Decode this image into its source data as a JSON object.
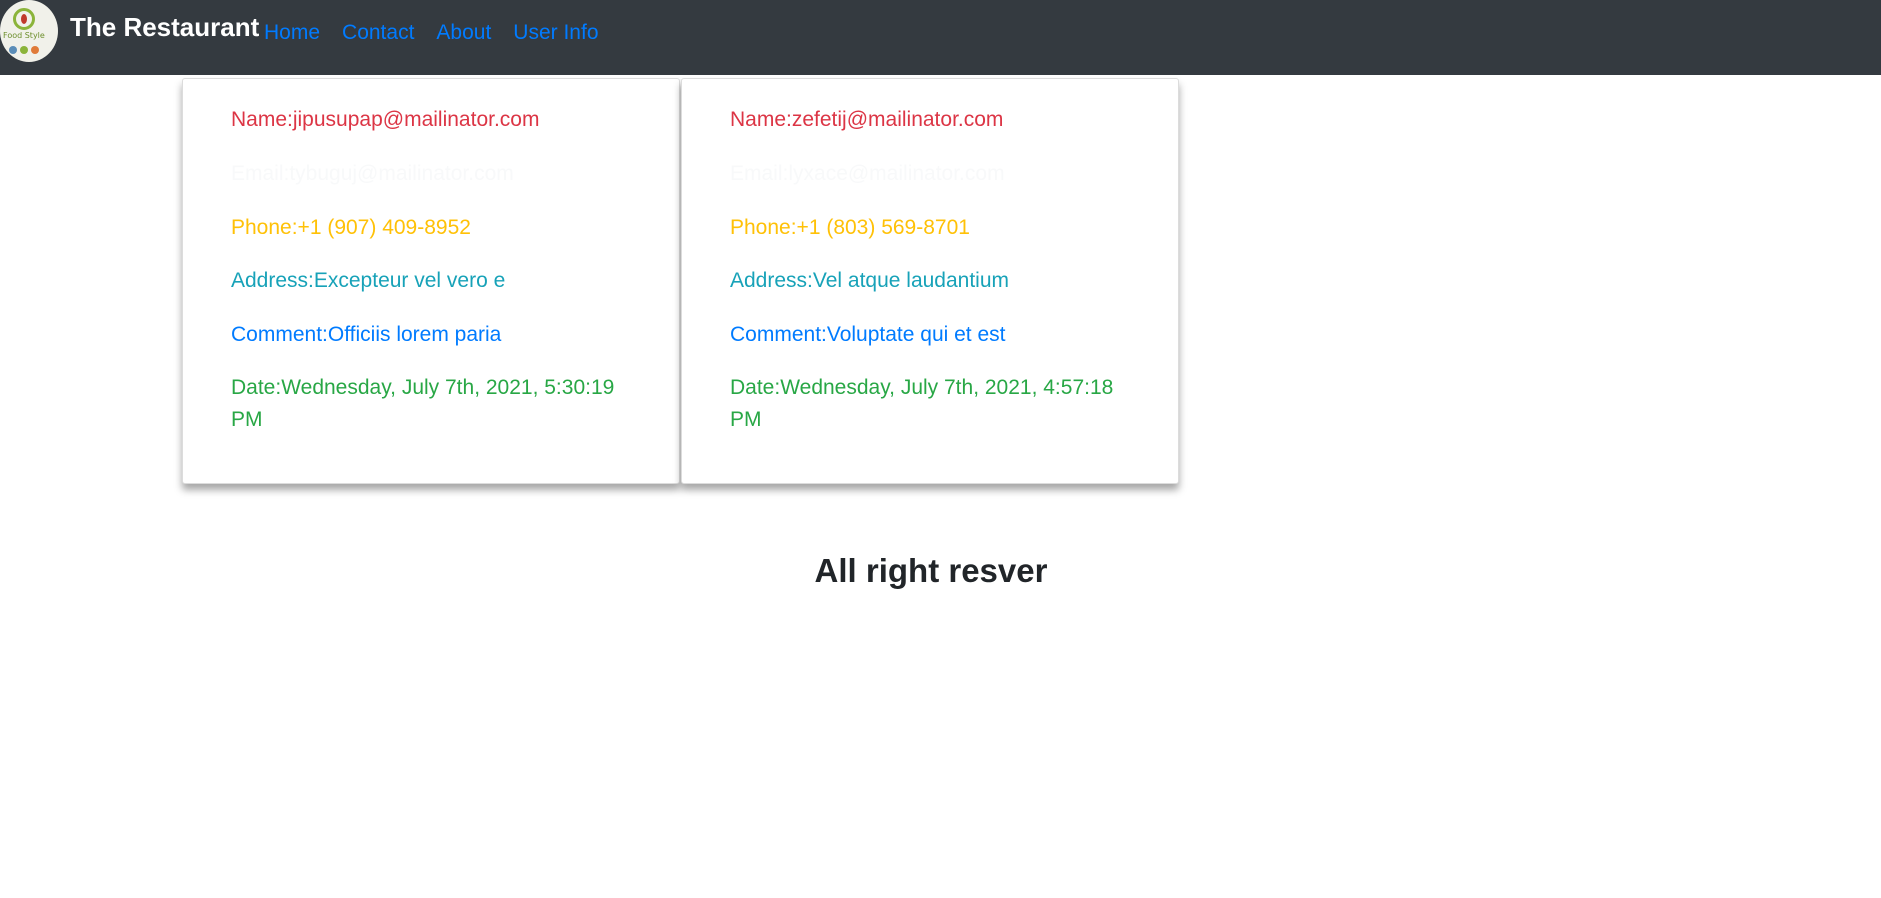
{
  "navbar": {
    "logo_text": "Food Style",
    "brand": "The Restaurant",
    "links": [
      "Home",
      "Contact",
      "About",
      "User Info"
    ]
  },
  "cards": [
    {
      "name": "Name:jipusupap@mailinator.com",
      "email": "Email:tybuguj@mailinator.com",
      "phone": "Phone:+1 (907) 409-8952",
      "address": "Address:Excepteur vel vero e",
      "comment": "Comment:Officiis lorem paria",
      "date": "Date:Wednesday, July 7th, 2021, 5:30:19 PM"
    },
    {
      "name": "Name:zefetij@mailinator.com",
      "email": "Email:lyxace@mailinator.com",
      "phone": "Phone:+1 (803) 569-8701",
      "address": "Address:Vel atque laudantium",
      "comment": "Comment:Voluptate qui et est",
      "date": "Date:Wednesday, July 7th, 2021, 4:57:18 PM"
    }
  ],
  "footer": "All right resver",
  "colors": {
    "navbar_bg": "#343a40",
    "link": "#007bff",
    "name": "#dc3545",
    "email": "#f8f9fa",
    "phone": "#ffc107",
    "address": "#17a2b8",
    "comment": "#007bff",
    "date": "#28a745"
  }
}
